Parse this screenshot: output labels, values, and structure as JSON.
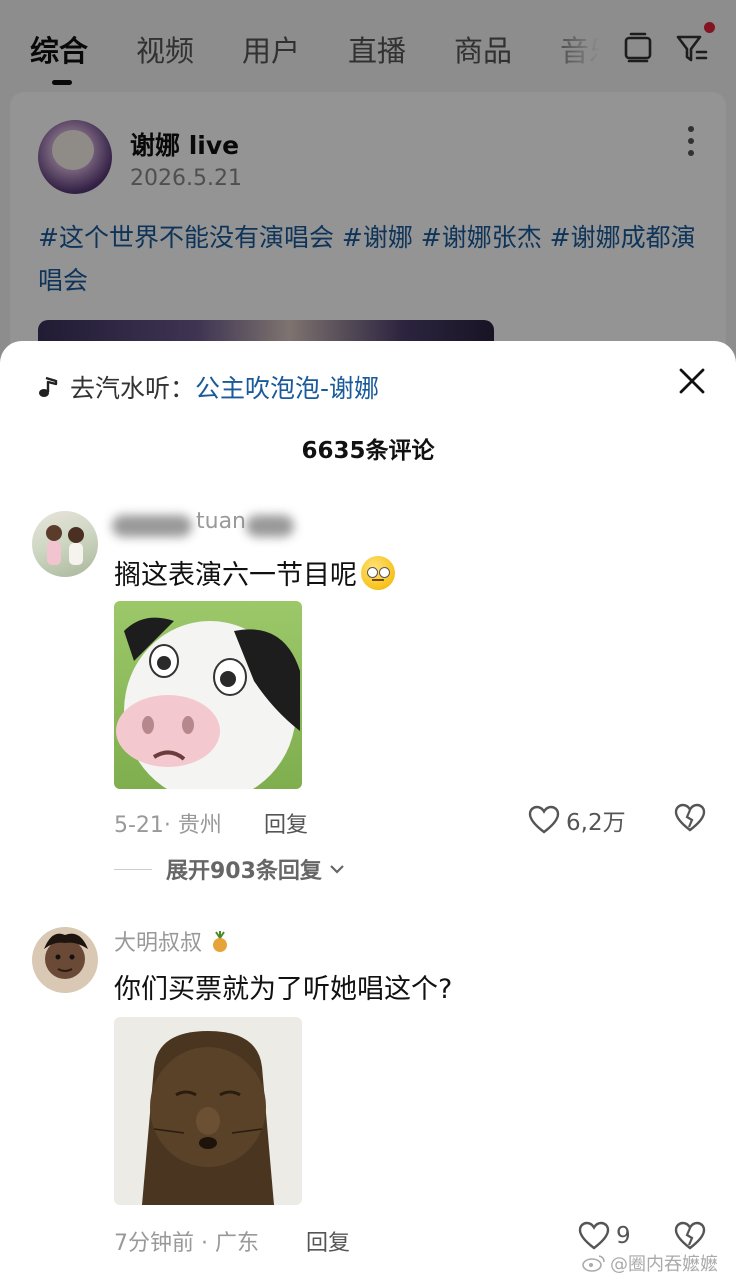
{
  "tabs": {
    "items": [
      {
        "label": "综合"
      },
      {
        "label": "视频"
      },
      {
        "label": "用户"
      },
      {
        "label": "直播"
      },
      {
        "label": "商品"
      },
      {
        "label": "音乐"
      }
    ],
    "active_index": 0
  },
  "post": {
    "username": "谢娜 live",
    "date": "2026.5.21",
    "hashtags": "#这个世界不能没有演唱会 #谢娜 #谢娜张杰 #谢娜成都演唱会"
  },
  "sheet": {
    "music_prefix": "去汽水听：",
    "music_song": "公主吹泡泡-谢娜",
    "comment_count": "6635条评论"
  },
  "comments": [
    {
      "name_visible": "tuan",
      "text": "搁这表演六一节目呢",
      "emoji": "eye-roll-emoji",
      "meta": "5-21· 贵州",
      "reply_label": "回复",
      "likes": "6,2万",
      "expand_label": "展开903条回复"
    },
    {
      "name_visible": "大明叔叔",
      "text": "你们买票就为了听她唱这个?",
      "meta": "7分钟前 · 广东",
      "reply_label": "回复",
      "likes": "9"
    }
  ],
  "watermark": "@圈内吞嬷嬷",
  "colors": {
    "link": "#1a5a9a",
    "notification_dot": "#e0243b",
    "muted_text": "#999999"
  }
}
